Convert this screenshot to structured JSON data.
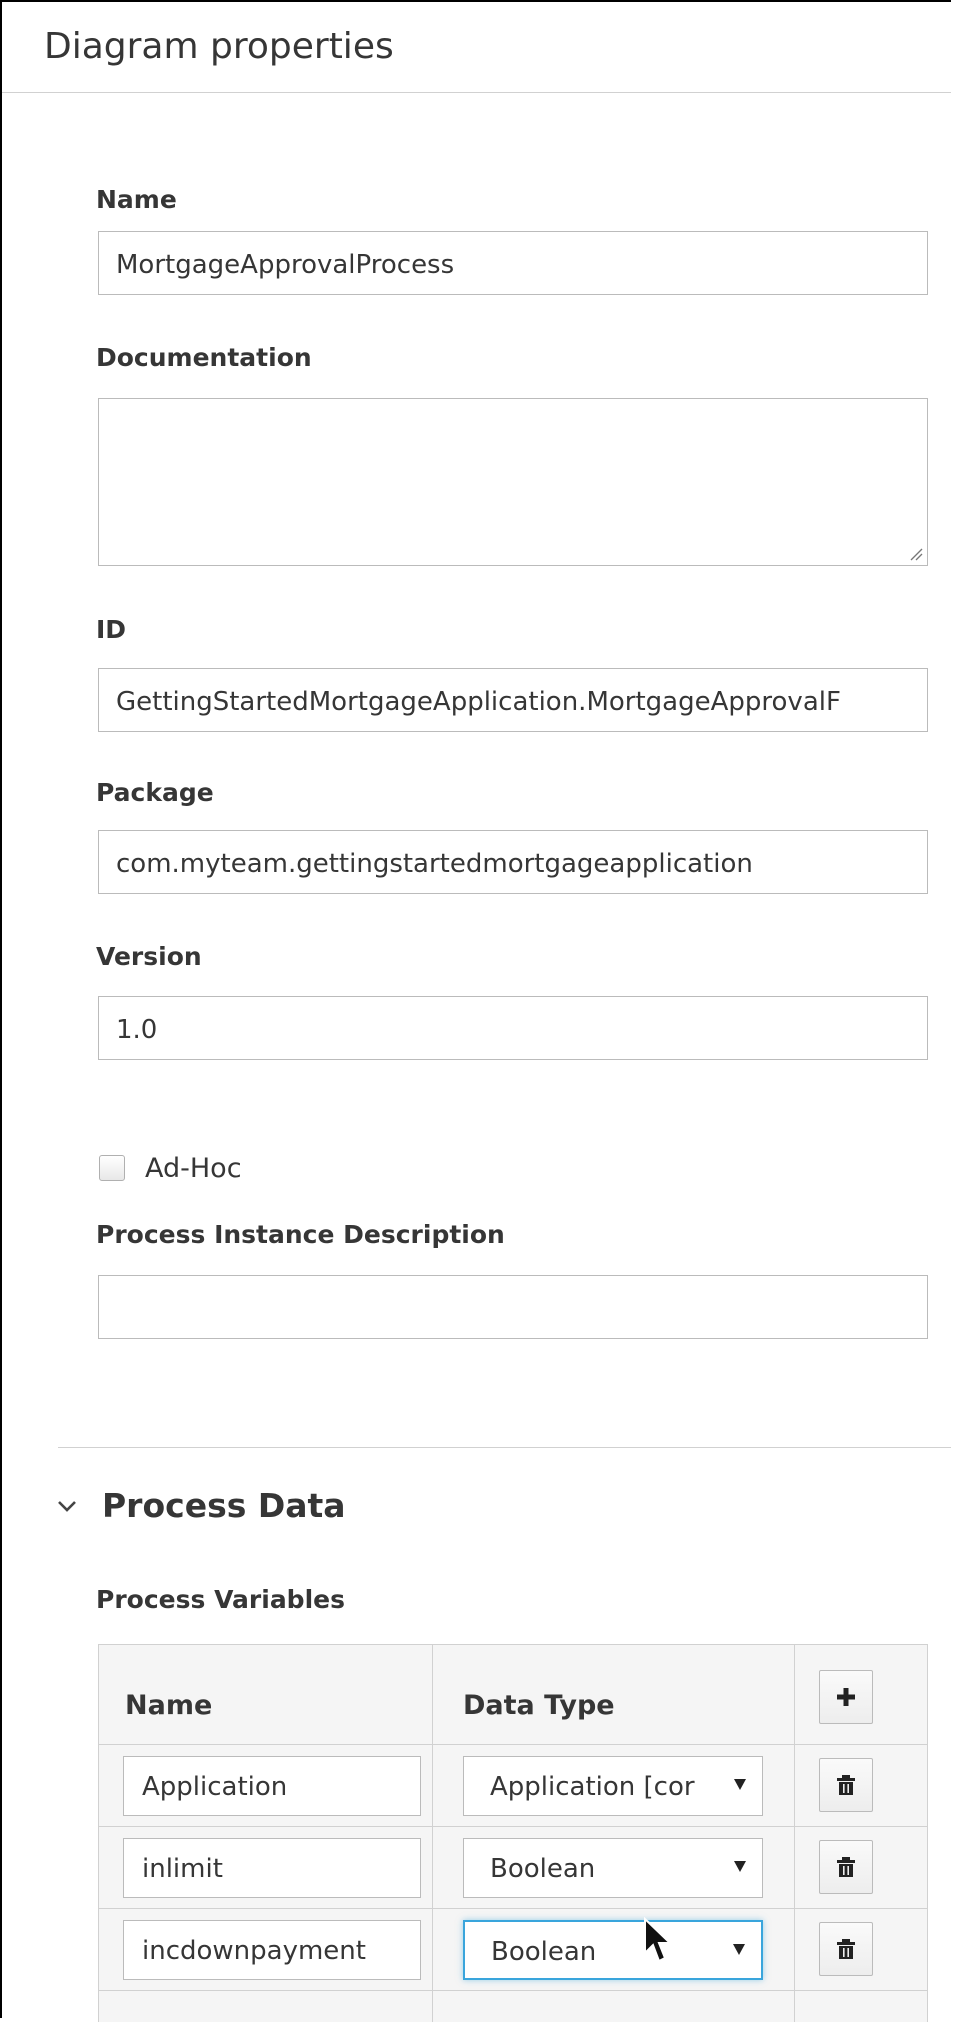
{
  "panel": {
    "title": "Diagram properties"
  },
  "fields": {
    "name": {
      "label": "Name",
      "value": "MortgageApprovalProcess"
    },
    "documentation": {
      "label": "Documentation",
      "value": ""
    },
    "id": {
      "label": "ID",
      "value": "GettingStartedMortgageApplication.MortgageApprovalF"
    },
    "package": {
      "label": "Package",
      "value": "com.myteam.gettingstartedmortgageapplication"
    },
    "version": {
      "label": "Version",
      "value": "1.0"
    },
    "adhoc": {
      "label": "Ad-Hoc",
      "checked": false
    },
    "process_instance_description": {
      "label": "Process Instance Description",
      "value": ""
    }
  },
  "process_data": {
    "section_title": "Process Data",
    "expanded": true,
    "variables_label": "Process Variables",
    "table": {
      "headers": {
        "name": "Name",
        "data_type": "Data Type"
      },
      "add_icon": "plus-icon",
      "delete_icon": "trash-icon",
      "rows": [
        {
          "name": "Application",
          "data_type": "Application [cor"
        },
        {
          "name": "inlimit",
          "data_type": "Boolean"
        },
        {
          "name": "incdownpayment",
          "data_type": "Boolean"
        }
      ]
    }
  },
  "colors": {
    "focus": "#39a5dc",
    "border": "#bbbbbb",
    "text": "#363636"
  }
}
